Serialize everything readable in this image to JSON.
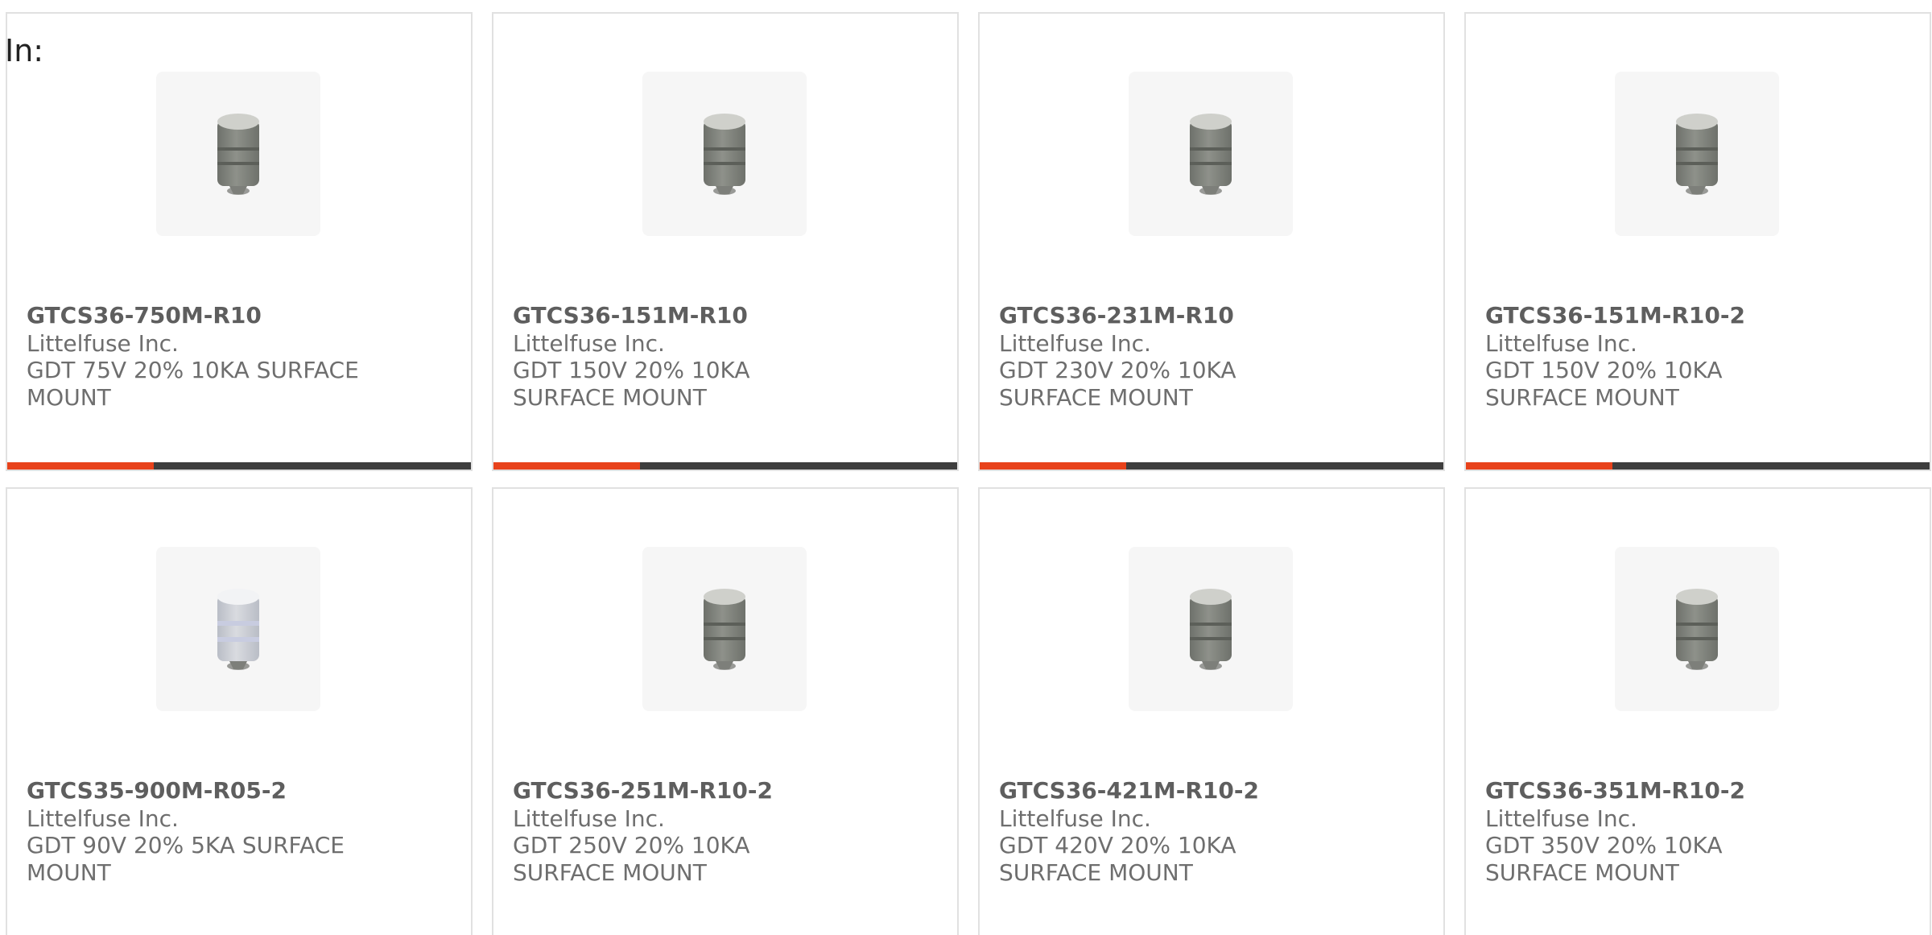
{
  "header": {
    "in_label": "In:"
  },
  "colors": {
    "card_border": "#e1e1e1",
    "bar_dark": "#3e3e3e",
    "bar_accent": "#e8421b",
    "text_part": "#5e5e5e",
    "text_meta": "#6e6e6e"
  },
  "products": [
    {
      "part": "GTCS36-750M-R10",
      "manufacturer": "Littelfuse Inc.",
      "description": "GDT 75V 20% 10KA SURFACE MOUNT",
      "image_icon": "gas-discharge-tube-icon",
      "accent_bar": true
    },
    {
      "part": "GTCS36-151M-R10",
      "manufacturer": "Littelfuse Inc.",
      "description": "GDT 150V 20% 10KA SURFACE MOUNT",
      "image_icon": "gas-discharge-tube-icon",
      "accent_bar": true
    },
    {
      "part": "GTCS36-231M-R10",
      "manufacturer": "Littelfuse Inc.",
      "description": "GDT 230V 20% 10KA SURFACE MOUNT",
      "image_icon": "gas-discharge-tube-icon",
      "accent_bar": true
    },
    {
      "part": "GTCS36-151M-R10-2",
      "manufacturer": "Littelfuse Inc.",
      "description": "GDT 150V 20% 10KA SURFACE MOUNT",
      "image_icon": "gas-discharge-tube-icon",
      "accent_bar": true
    },
    {
      "part": "GTCS35-900M-R05-2",
      "manufacturer": "Littelfuse Inc.",
      "description": "GDT 90V 20% 5KA SURFACE MOUNT",
      "image_icon": "gas-discharge-tube-white-icon",
      "accent_bar": false
    },
    {
      "part": "GTCS36-251M-R10-2",
      "manufacturer": "Littelfuse Inc.",
      "description": "GDT 250V 20% 10KA SURFACE MOUNT",
      "image_icon": "gas-discharge-tube-icon",
      "accent_bar": false
    },
    {
      "part": "GTCS36-421M-R10-2",
      "manufacturer": "Littelfuse Inc.",
      "description": "GDT 420V 20% 10KA SURFACE MOUNT",
      "image_icon": "gas-discharge-tube-icon",
      "accent_bar": false
    },
    {
      "part": "GTCS36-351M-R10-2",
      "manufacturer": "Littelfuse Inc.",
      "description": "GDT 350V 20% 10KA SURFACE MOUNT",
      "image_icon": "gas-discharge-tube-icon",
      "accent_bar": false
    }
  ]
}
